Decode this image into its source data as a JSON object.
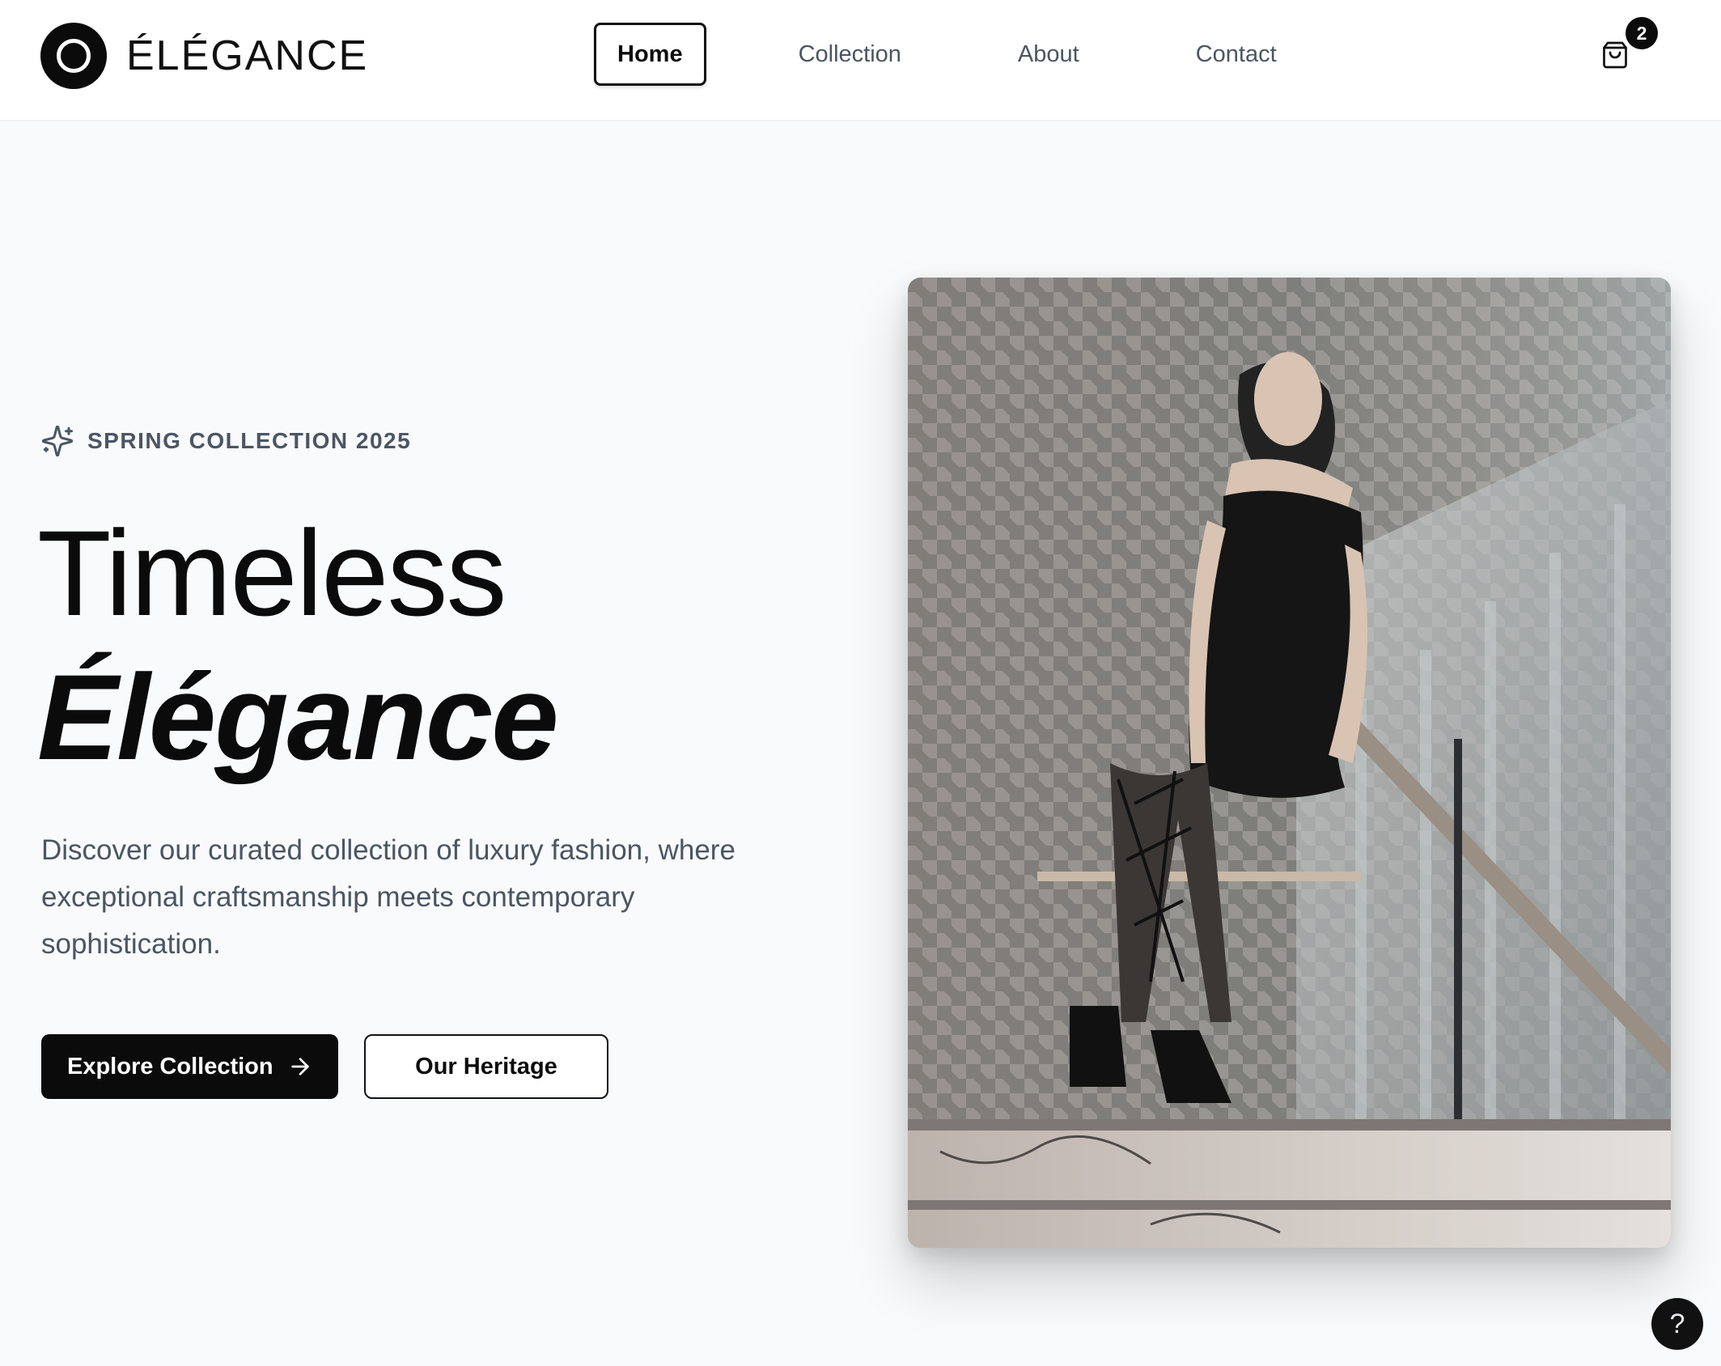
{
  "brand": {
    "name": "ÉLÉGANCE",
    "logo_icon": "circle-logo-icon"
  },
  "nav": {
    "items": [
      {
        "label": "Home",
        "active": true
      },
      {
        "label": "Collection",
        "active": false
      },
      {
        "label": "About",
        "active": false
      },
      {
        "label": "Contact",
        "active": false
      }
    ]
  },
  "cart": {
    "icon": "shopping-bag-icon",
    "count": "2"
  },
  "hero": {
    "eyebrow_icon": "sparkles-icon",
    "eyebrow": "SPRING COLLECTION 2025",
    "title_line1": "Timeless",
    "title_line2": "Élégance",
    "description": "Discover our curated collection of luxury fashion, where exceptional craftsmanship meets contemporary sophistication.",
    "primary_button": "Explore Collection",
    "primary_button_icon": "arrow-right-icon",
    "secondary_button": "Our Heritage",
    "image_subject": "woman in black dress descending marble staircase"
  },
  "help_button": {
    "label": "?",
    "icon": "help-icon"
  },
  "colors": {
    "primary": "#0b0b0b",
    "text_muted": "#4b5563",
    "background": "#f9fafb",
    "header_bg": "#ffffff"
  }
}
